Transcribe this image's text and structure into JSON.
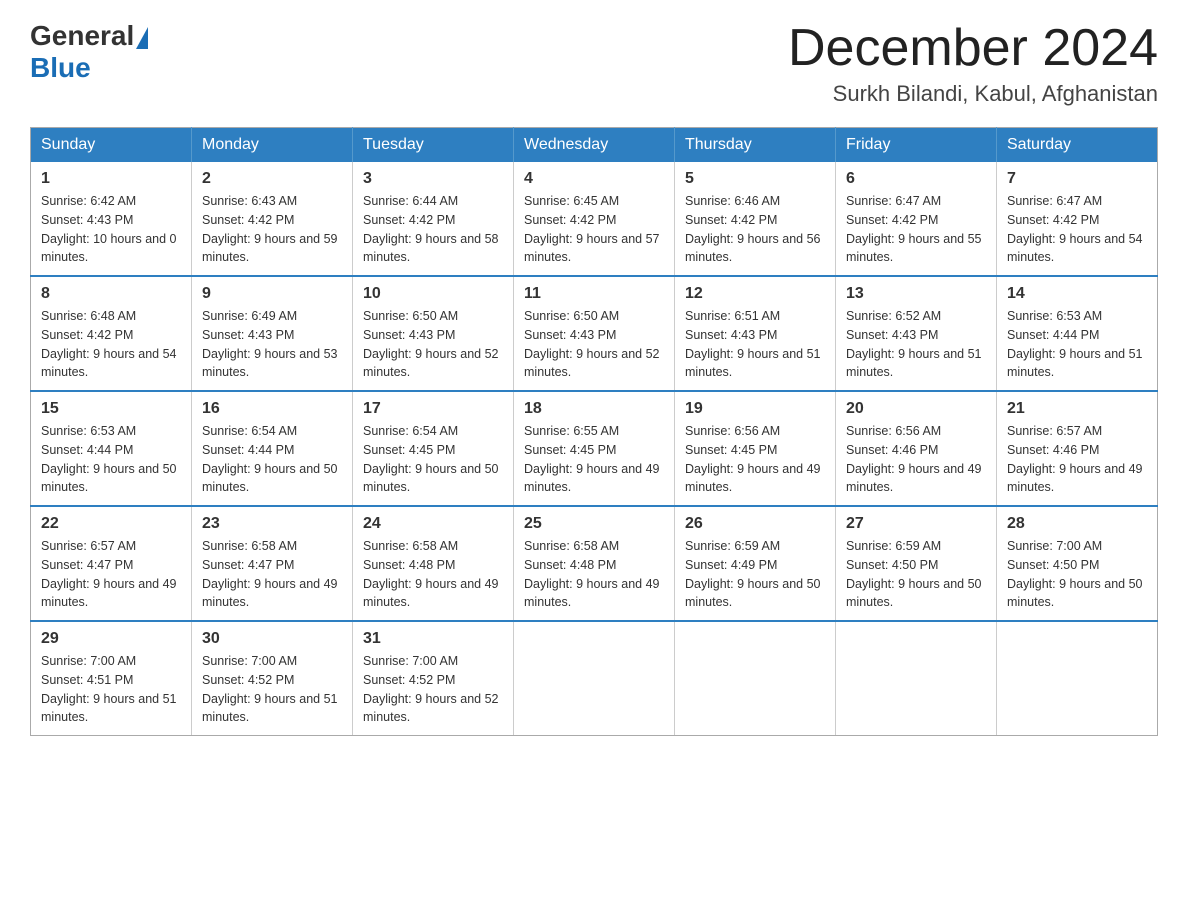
{
  "logo": {
    "general": "General",
    "blue": "Blue"
  },
  "title": {
    "month": "December 2024",
    "location": "Surkh Bilandi, Kabul, Afghanistan"
  },
  "weekdays": [
    "Sunday",
    "Monday",
    "Tuesday",
    "Wednesday",
    "Thursday",
    "Friday",
    "Saturday"
  ],
  "weeks": [
    [
      {
        "day": "1",
        "sunrise": "6:42 AM",
        "sunset": "4:43 PM",
        "daylight": "10 hours and 0 minutes."
      },
      {
        "day": "2",
        "sunrise": "6:43 AM",
        "sunset": "4:42 PM",
        "daylight": "9 hours and 59 minutes."
      },
      {
        "day": "3",
        "sunrise": "6:44 AM",
        "sunset": "4:42 PM",
        "daylight": "9 hours and 58 minutes."
      },
      {
        "day": "4",
        "sunrise": "6:45 AM",
        "sunset": "4:42 PM",
        "daylight": "9 hours and 57 minutes."
      },
      {
        "day": "5",
        "sunrise": "6:46 AM",
        "sunset": "4:42 PM",
        "daylight": "9 hours and 56 minutes."
      },
      {
        "day": "6",
        "sunrise": "6:47 AM",
        "sunset": "4:42 PM",
        "daylight": "9 hours and 55 minutes."
      },
      {
        "day": "7",
        "sunrise": "6:47 AM",
        "sunset": "4:42 PM",
        "daylight": "9 hours and 54 minutes."
      }
    ],
    [
      {
        "day": "8",
        "sunrise": "6:48 AM",
        "sunset": "4:42 PM",
        "daylight": "9 hours and 54 minutes."
      },
      {
        "day": "9",
        "sunrise": "6:49 AM",
        "sunset": "4:43 PM",
        "daylight": "9 hours and 53 minutes."
      },
      {
        "day": "10",
        "sunrise": "6:50 AM",
        "sunset": "4:43 PM",
        "daylight": "9 hours and 52 minutes."
      },
      {
        "day": "11",
        "sunrise": "6:50 AM",
        "sunset": "4:43 PM",
        "daylight": "9 hours and 52 minutes."
      },
      {
        "day": "12",
        "sunrise": "6:51 AM",
        "sunset": "4:43 PM",
        "daylight": "9 hours and 51 minutes."
      },
      {
        "day": "13",
        "sunrise": "6:52 AM",
        "sunset": "4:43 PM",
        "daylight": "9 hours and 51 minutes."
      },
      {
        "day": "14",
        "sunrise": "6:53 AM",
        "sunset": "4:44 PM",
        "daylight": "9 hours and 51 minutes."
      }
    ],
    [
      {
        "day": "15",
        "sunrise": "6:53 AM",
        "sunset": "4:44 PM",
        "daylight": "9 hours and 50 minutes."
      },
      {
        "day": "16",
        "sunrise": "6:54 AM",
        "sunset": "4:44 PM",
        "daylight": "9 hours and 50 minutes."
      },
      {
        "day": "17",
        "sunrise": "6:54 AM",
        "sunset": "4:45 PM",
        "daylight": "9 hours and 50 minutes."
      },
      {
        "day": "18",
        "sunrise": "6:55 AM",
        "sunset": "4:45 PM",
        "daylight": "9 hours and 49 minutes."
      },
      {
        "day": "19",
        "sunrise": "6:56 AM",
        "sunset": "4:45 PM",
        "daylight": "9 hours and 49 minutes."
      },
      {
        "day": "20",
        "sunrise": "6:56 AM",
        "sunset": "4:46 PM",
        "daylight": "9 hours and 49 minutes."
      },
      {
        "day": "21",
        "sunrise": "6:57 AM",
        "sunset": "4:46 PM",
        "daylight": "9 hours and 49 minutes."
      }
    ],
    [
      {
        "day": "22",
        "sunrise": "6:57 AM",
        "sunset": "4:47 PM",
        "daylight": "9 hours and 49 minutes."
      },
      {
        "day": "23",
        "sunrise": "6:58 AM",
        "sunset": "4:47 PM",
        "daylight": "9 hours and 49 minutes."
      },
      {
        "day": "24",
        "sunrise": "6:58 AM",
        "sunset": "4:48 PM",
        "daylight": "9 hours and 49 minutes."
      },
      {
        "day": "25",
        "sunrise": "6:58 AM",
        "sunset": "4:48 PM",
        "daylight": "9 hours and 49 minutes."
      },
      {
        "day": "26",
        "sunrise": "6:59 AM",
        "sunset": "4:49 PM",
        "daylight": "9 hours and 50 minutes."
      },
      {
        "day": "27",
        "sunrise": "6:59 AM",
        "sunset": "4:50 PM",
        "daylight": "9 hours and 50 minutes."
      },
      {
        "day": "28",
        "sunrise": "7:00 AM",
        "sunset": "4:50 PM",
        "daylight": "9 hours and 50 minutes."
      }
    ],
    [
      {
        "day": "29",
        "sunrise": "7:00 AM",
        "sunset": "4:51 PM",
        "daylight": "9 hours and 51 minutes."
      },
      {
        "day": "30",
        "sunrise": "7:00 AM",
        "sunset": "4:52 PM",
        "daylight": "9 hours and 51 minutes."
      },
      {
        "day": "31",
        "sunrise": "7:00 AM",
        "sunset": "4:52 PM",
        "daylight": "9 hours and 52 minutes."
      },
      null,
      null,
      null,
      null
    ]
  ]
}
